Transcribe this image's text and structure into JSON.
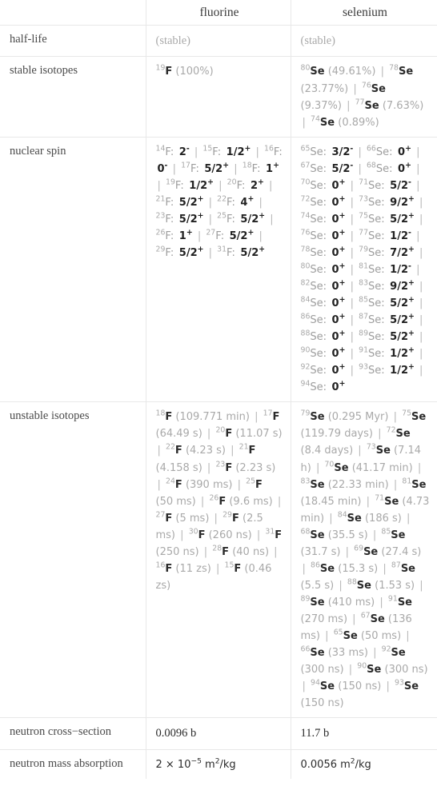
{
  "table": {
    "columns": [
      {
        "key": "label",
        "header": ""
      },
      {
        "key": "fluorine",
        "header": "fluorine"
      },
      {
        "key": "selenium",
        "header": "selenium"
      }
    ],
    "rows": [
      {
        "label": "half-life",
        "fluorine": {
          "text": "(stable)",
          "muted": true
        },
        "selenium": {
          "text": "(stable)",
          "muted": true
        }
      },
      {
        "label": "stable isotopes",
        "fluorine": {
          "isotopes": [
            {
              "mass": "19",
              "symbol": "F",
              "value": "(100%)"
            }
          ]
        },
        "selenium": {
          "isotopes": [
            {
              "mass": "80",
              "symbol": "Se",
              "value": "(49.61%)"
            },
            {
              "mass": "78",
              "symbol": "Se",
              "value": "(23.77%)"
            },
            {
              "mass": "76",
              "symbol": "Se",
              "value": "(9.37%)"
            },
            {
              "mass": "77",
              "symbol": "Se",
              "value": "(7.63%)"
            },
            {
              "mass": "74",
              "symbol": "Se",
              "value": "(0.89%)"
            }
          ]
        }
      },
      {
        "label": "nuclear spin",
        "fluorine": {
          "spins": [
            {
              "mass": "14",
              "symbol": "F",
              "spin": "2",
              "sign": "-"
            },
            {
              "mass": "15",
              "symbol": "F",
              "spin": "1/2",
              "sign": "+"
            },
            {
              "mass": "16",
              "symbol": "F",
              "spin": "0",
              "sign": "-"
            },
            {
              "mass": "17",
              "symbol": "F",
              "spin": "5/2",
              "sign": "+"
            },
            {
              "mass": "18",
              "symbol": "F",
              "spin": "1",
              "sign": "+"
            },
            {
              "mass": "19",
              "symbol": "F",
              "spin": "1/2",
              "sign": "+"
            },
            {
              "mass": "20",
              "symbol": "F",
              "spin": "2",
              "sign": "+"
            },
            {
              "mass": "21",
              "symbol": "F",
              "spin": "5/2",
              "sign": "+"
            },
            {
              "mass": "22",
              "symbol": "F",
              "spin": "4",
              "sign": "+"
            },
            {
              "mass": "23",
              "symbol": "F",
              "spin": "5/2",
              "sign": "+"
            },
            {
              "mass": "25",
              "symbol": "F",
              "spin": "5/2",
              "sign": "+"
            },
            {
              "mass": "26",
              "symbol": "F",
              "spin": "1",
              "sign": "+"
            },
            {
              "mass": "27",
              "symbol": "F",
              "spin": "5/2",
              "sign": "+"
            },
            {
              "mass": "29",
              "symbol": "F",
              "spin": "5/2",
              "sign": "+"
            },
            {
              "mass": "31",
              "symbol": "F",
              "spin": "5/2",
              "sign": "+"
            }
          ]
        },
        "selenium": {
          "spins": [
            {
              "mass": "65",
              "symbol": "Se",
              "spin": "3/2",
              "sign": "-"
            },
            {
              "mass": "66",
              "symbol": "Se",
              "spin": "0",
              "sign": "+"
            },
            {
              "mass": "67",
              "symbol": "Se",
              "spin": "5/2",
              "sign": "-"
            },
            {
              "mass": "68",
              "symbol": "Se",
              "spin": "0",
              "sign": "+"
            },
            {
              "mass": "70",
              "symbol": "Se",
              "spin": "0",
              "sign": "+"
            },
            {
              "mass": "71",
              "symbol": "Se",
              "spin": "5/2",
              "sign": "-"
            },
            {
              "mass": "72",
              "symbol": "Se",
              "spin": "0",
              "sign": "+"
            },
            {
              "mass": "73",
              "symbol": "Se",
              "spin": "9/2",
              "sign": "+"
            },
            {
              "mass": "74",
              "symbol": "Se",
              "spin": "0",
              "sign": "+"
            },
            {
              "mass": "75",
              "symbol": "Se",
              "spin": "5/2",
              "sign": "+"
            },
            {
              "mass": "76",
              "symbol": "Se",
              "spin": "0",
              "sign": "+"
            },
            {
              "mass": "77",
              "symbol": "Se",
              "spin": "1/2",
              "sign": "-"
            },
            {
              "mass": "78",
              "symbol": "Se",
              "spin": "0",
              "sign": "+"
            },
            {
              "mass": "79",
              "symbol": "Se",
              "spin": "7/2",
              "sign": "+"
            },
            {
              "mass": "80",
              "symbol": "Se",
              "spin": "0",
              "sign": "+"
            },
            {
              "mass": "81",
              "symbol": "Se",
              "spin": "1/2",
              "sign": "-"
            },
            {
              "mass": "82",
              "symbol": "Se",
              "spin": "0",
              "sign": "+"
            },
            {
              "mass": "83",
              "symbol": "Se",
              "spin": "9/2",
              "sign": "+"
            },
            {
              "mass": "84",
              "symbol": "Se",
              "spin": "0",
              "sign": "+"
            },
            {
              "mass": "85",
              "symbol": "Se",
              "spin": "5/2",
              "sign": "+"
            },
            {
              "mass": "86",
              "symbol": "Se",
              "spin": "0",
              "sign": "+"
            },
            {
              "mass": "87",
              "symbol": "Se",
              "spin": "5/2",
              "sign": "+"
            },
            {
              "mass": "88",
              "symbol": "Se",
              "spin": "0",
              "sign": "+"
            },
            {
              "mass": "89",
              "symbol": "Se",
              "spin": "5/2",
              "sign": "+"
            },
            {
              "mass": "90",
              "symbol": "Se",
              "spin": "0",
              "sign": "+"
            },
            {
              "mass": "91",
              "symbol": "Se",
              "spin": "1/2",
              "sign": "+"
            },
            {
              "mass": "92",
              "symbol": "Se",
              "spin": "0",
              "sign": "+"
            },
            {
              "mass": "93",
              "symbol": "Se",
              "spin": "1/2",
              "sign": "+"
            },
            {
              "mass": "94",
              "symbol": "Se",
              "spin": "0",
              "sign": "+"
            }
          ]
        }
      },
      {
        "label": "unstable isotopes",
        "fluorine": {
          "isotopes": [
            {
              "mass": "18",
              "symbol": "F",
              "value": "(109.771 min)"
            },
            {
              "mass": "17",
              "symbol": "F",
              "value": "(64.49 s)"
            },
            {
              "mass": "20",
              "symbol": "F",
              "value": "(11.07 s)"
            },
            {
              "mass": "22",
              "symbol": "F",
              "value": "(4.23 s)"
            },
            {
              "mass": "21",
              "symbol": "F",
              "value": "(4.158 s)"
            },
            {
              "mass": "23",
              "symbol": "F",
              "value": "(2.23 s)"
            },
            {
              "mass": "24",
              "symbol": "F",
              "value": "(390 ms)"
            },
            {
              "mass": "25",
              "symbol": "F",
              "value": "(50 ms)"
            },
            {
              "mass": "26",
              "symbol": "F",
              "value": "(9.6 ms)"
            },
            {
              "mass": "27",
              "symbol": "F",
              "value": "(5 ms)"
            },
            {
              "mass": "29",
              "symbol": "F",
              "value": "(2.5 ms)"
            },
            {
              "mass": "30",
              "symbol": "F",
              "value": "(260 ns)"
            },
            {
              "mass": "31",
              "symbol": "F",
              "value": "(250 ns)"
            },
            {
              "mass": "28",
              "symbol": "F",
              "value": "(40 ns)"
            },
            {
              "mass": "16",
              "symbol": "F",
              "value": "(11 zs)"
            },
            {
              "mass": "15",
              "symbol": "F",
              "value": "(0.46 zs)"
            }
          ]
        },
        "selenium": {
          "isotopes": [
            {
              "mass": "79",
              "symbol": "Se",
              "value": "(0.295 Myr)"
            },
            {
              "mass": "75",
              "symbol": "Se",
              "value": "(119.79 days)"
            },
            {
              "mass": "72",
              "symbol": "Se",
              "value": "(8.4 days)"
            },
            {
              "mass": "73",
              "symbol": "Se",
              "value": "(7.14 h)"
            },
            {
              "mass": "70",
              "symbol": "Se",
              "value": "(41.17 min)"
            },
            {
              "mass": "83",
              "symbol": "Se",
              "value": "(22.33 min)"
            },
            {
              "mass": "81",
              "symbol": "Se",
              "value": "(18.45 min)"
            },
            {
              "mass": "71",
              "symbol": "Se",
              "value": "(4.73 min)"
            },
            {
              "mass": "84",
              "symbol": "Se",
              "value": "(186 s)"
            },
            {
              "mass": "68",
              "symbol": "Se",
              "value": "(35.5 s)"
            },
            {
              "mass": "85",
              "symbol": "Se",
              "value": "(31.7 s)"
            },
            {
              "mass": "69",
              "symbol": "Se",
              "value": "(27.4 s)"
            },
            {
              "mass": "86",
              "symbol": "Se",
              "value": "(15.3 s)"
            },
            {
              "mass": "87",
              "symbol": "Se",
              "value": "(5.5 s)"
            },
            {
              "mass": "88",
              "symbol": "Se",
              "value": "(1.53 s)"
            },
            {
              "mass": "89",
              "symbol": "Se",
              "value": "(410 ms)"
            },
            {
              "mass": "91",
              "symbol": "Se",
              "value": "(270 ms)"
            },
            {
              "mass": "67",
              "symbol": "Se",
              "value": "(136 ms)"
            },
            {
              "mass": "65",
              "symbol": "Se",
              "value": "(50 ms)"
            },
            {
              "mass": "66",
              "symbol": "Se",
              "value": "(33 ms)"
            },
            {
              "mass": "92",
              "symbol": "Se",
              "value": "(300 ns)"
            },
            {
              "mass": "90",
              "symbol": "Se",
              "value": "(300 ns)"
            },
            {
              "mass": "94",
              "symbol": "Se",
              "value": "(150 ns)"
            },
            {
              "mass": "93",
              "symbol": "Se",
              "value": "(150 ns)"
            }
          ]
        }
      },
      {
        "label": "neutron cross−section",
        "fluorine": {
          "text": "0.0096 b"
        },
        "selenium": {
          "text": "11.7 b"
        }
      },
      {
        "label": "neutron mass absorption",
        "fluorine": {
          "sci": {
            "mantissa": "2",
            "times": "×",
            "base": "10",
            "exp": "−5",
            "unitPre": "m",
            "unitSup": "2",
            "unitPost": "/kg"
          }
        },
        "selenium": {
          "sci": {
            "mantissa": "0.0056",
            "unitPre": "m",
            "unitSup": "2",
            "unitPost": "/kg"
          }
        }
      }
    ]
  },
  "colors": {
    "border": "#e8e8e8",
    "text": "#3b3b3b",
    "muted": "#a9a9a9",
    "separator": "#b8b8b8"
  }
}
